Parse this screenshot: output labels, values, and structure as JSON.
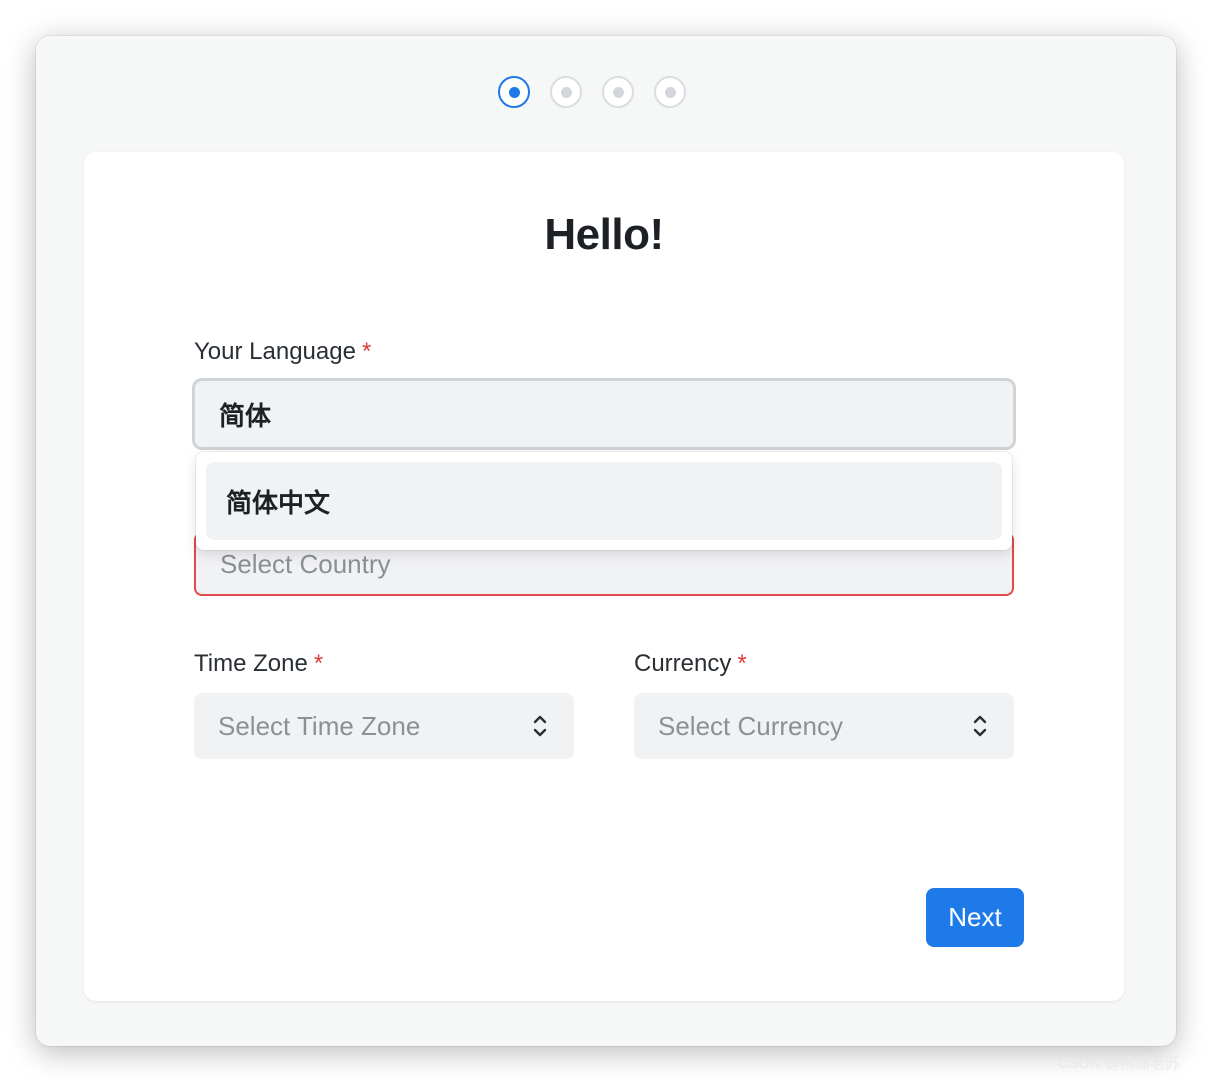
{
  "steps": {
    "count": 4,
    "active_index": 0
  },
  "title": "Hello!",
  "language": {
    "label": "Your Language",
    "required_mark": "*",
    "value": "简体",
    "suggestions": [
      "简体中文"
    ]
  },
  "country": {
    "placeholder": "Select Country"
  },
  "time_zone": {
    "label": "Time Zone",
    "required_mark": "*",
    "placeholder": "Select Time Zone"
  },
  "currency": {
    "label": "Currency",
    "required_mark": "*",
    "placeholder": "Select Currency"
  },
  "next_button": "Next",
  "watermark": "CSDN @杨浦老苏",
  "colors": {
    "accent": "#1f7ae9",
    "error": "#e03b3b",
    "field_bg": "#f1f2f4",
    "window_bg": "#f6f7f7"
  }
}
